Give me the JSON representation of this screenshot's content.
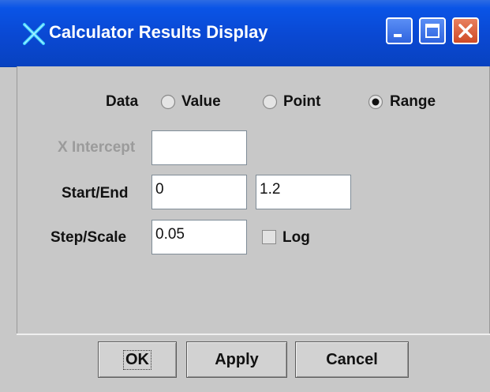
{
  "window": {
    "title": "Calculator Results Display",
    "icon": "x-app-icon",
    "controls": [
      "minimize-icon",
      "maximize-icon",
      "close-icon"
    ]
  },
  "form": {
    "data_label": "Data",
    "data_options": [
      {
        "label": "Value",
        "selected": false
      },
      {
        "label": "Point",
        "selected": false
      },
      {
        "label": "Range",
        "selected": true
      }
    ],
    "x_intercept": {
      "label": "X Intercept",
      "value": "",
      "enabled": false
    },
    "start_end": {
      "label": "Start/End",
      "start": "0",
      "end": "1.2"
    },
    "step_scale": {
      "label": "Step/Scale",
      "value": "0.05"
    },
    "log": {
      "label": "Log",
      "checked": false
    }
  },
  "buttons": {
    "ok": "OK",
    "apply": "Apply",
    "cancel": "Cancel"
  },
  "colors": {
    "titlebar": "#0a48d2",
    "panel": "#c8c8c8",
    "disabled_text": "#9b9b9b",
    "close_button": "#cf4a26"
  }
}
